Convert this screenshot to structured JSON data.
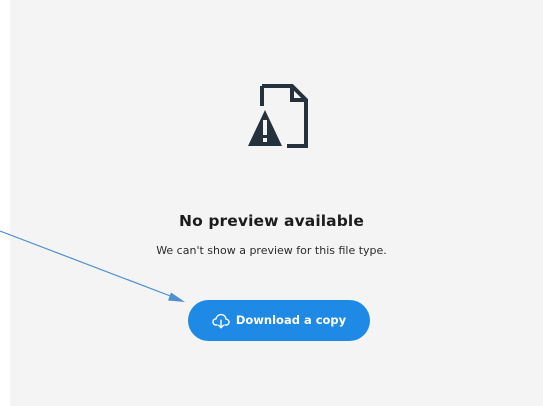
{
  "preview": {
    "title": "No preview available",
    "message": "We can't show a preview for this file type."
  },
  "download_button": {
    "label": "Download a copy",
    "icon": "cloud-download-icon"
  },
  "file_icon": {
    "icon": "file-warning-icon"
  },
  "colors": {
    "panel_background": "#f4f4f4",
    "button_background": "#1f8ae6",
    "annotation_arrow": "#4f8fd0",
    "icon_dark": "#25313c"
  }
}
